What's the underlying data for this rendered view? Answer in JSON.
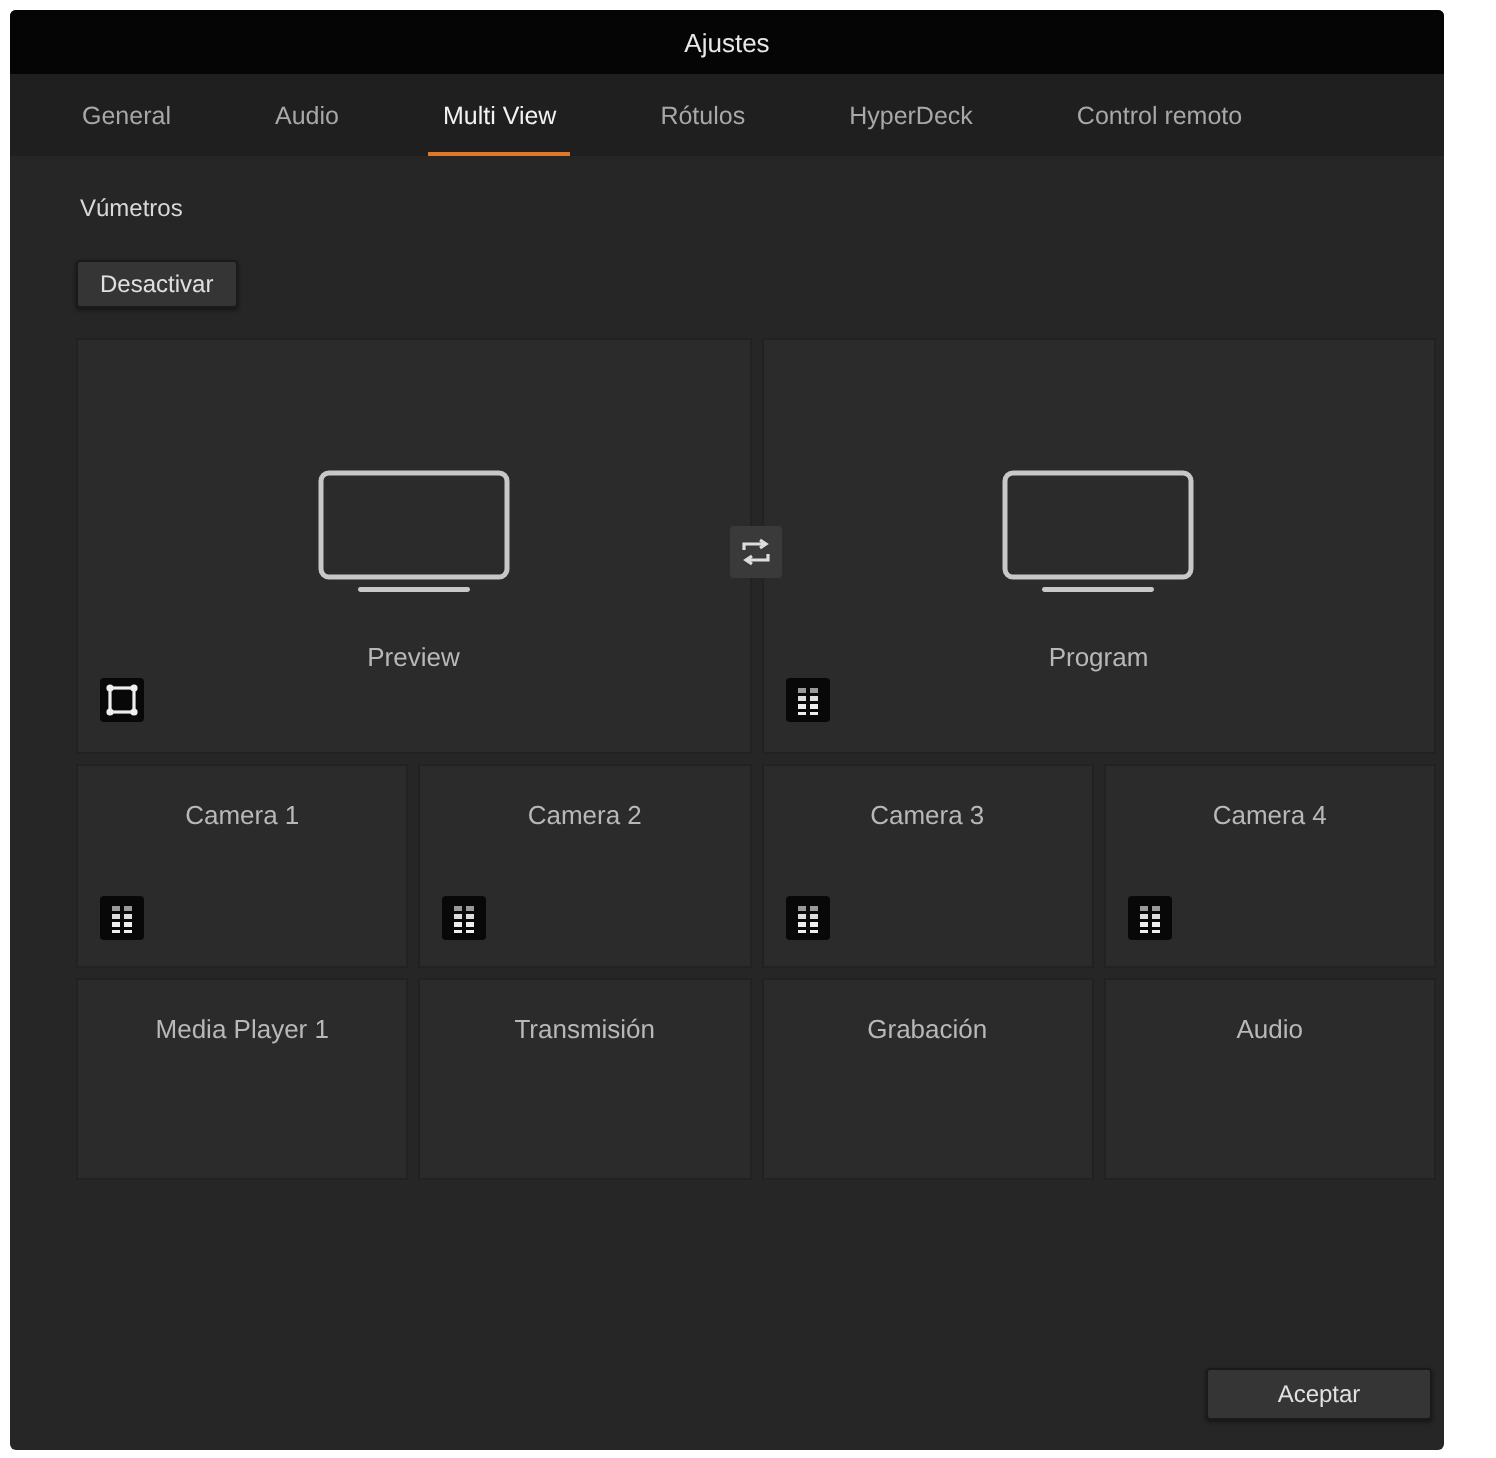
{
  "window": {
    "title": "Ajustes"
  },
  "tabs": [
    {
      "label": "General",
      "selected": false
    },
    {
      "label": "Audio",
      "selected": false
    },
    {
      "label": "Multi View",
      "selected": true
    },
    {
      "label": "Rótulos",
      "selected": false
    },
    {
      "label": "HyperDeck",
      "selected": false
    },
    {
      "label": "Control remoto",
      "selected": false
    }
  ],
  "section": {
    "label": "Vúmetros",
    "button": "Desactivar"
  },
  "main_views": [
    {
      "label": "Preview",
      "kind": "preview",
      "meter": false
    },
    {
      "label": "Program",
      "kind": "program",
      "meter": true
    }
  ],
  "windows": [
    {
      "label": "Camera 1",
      "meter": true
    },
    {
      "label": "Camera 2",
      "meter": true
    },
    {
      "label": "Camera 3",
      "meter": true
    },
    {
      "label": "Camera 4",
      "meter": true
    },
    {
      "label": "Media Player 1",
      "meter": false
    },
    {
      "label": "Transmisión",
      "meter": false
    },
    {
      "label": "Grabación",
      "meter": false
    },
    {
      "label": "Audio",
      "meter": false
    }
  ],
  "footer": {
    "button": "Aceptar"
  }
}
